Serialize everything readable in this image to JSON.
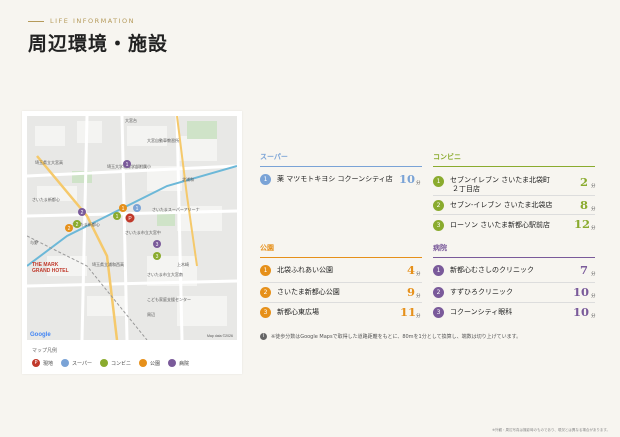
{
  "header": {
    "eyebrow": "LIFE INFORMATION",
    "title": "周辺環境・施設"
  },
  "colors": {
    "super": "#7aa3d6",
    "conv": "#8aab2e",
    "park": "#e6901a",
    "hosp": "#7a5a9a",
    "gen": "#c0392b",
    "gold": "#b59a5a"
  },
  "legend": {
    "title": "マップ凡例",
    "items": [
      {
        "mark": "P",
        "label": "現地"
      },
      {
        "mark": "",
        "label": "スーパー"
      },
      {
        "mark": "",
        "label": "コンビニ"
      },
      {
        "mark": "",
        "label": "公園"
      },
      {
        "mark": "",
        "label": "病院"
      }
    ]
  },
  "map": {
    "credit": "Map data ©2026",
    "logo": "Google",
    "labels": [
      "大宮台",
      "大宮自動車教習所",
      "大宮区",
      "埼玉県立大宮高",
      "埼玉大学教育学部附属小",
      "北浦和",
      "さいたま新都心",
      "さいたま新都心",
      "THE MARK",
      "GRAND HOTEL",
      "埼玉県立浦和西高",
      "さいたまスーパーアリーナ",
      "上木崎",
      "与野",
      "さいたま市立大宮中",
      "さいたま市立大宮南",
      "こども家庭支援センター",
      "周辺"
    ]
  },
  "sections": {
    "super": {
      "title": "スーパー",
      "items": [
        {
          "n": "1",
          "name": "薬 マツモトキヨシ コクーンシティ店",
          "min": "10",
          "unit": "分"
        }
      ]
    },
    "conv": {
      "title": "コンビニ",
      "items": [
        {
          "n": "1",
          "name": "セブンイレブン さいたま北袋町",
          "name2": "２丁目店",
          "min": "2",
          "unit": "分"
        },
        {
          "n": "2",
          "name": "セブン-イレブン さいたま北袋店",
          "min": "8",
          "unit": "分"
        },
        {
          "n": "3",
          "name": "ローソン さいたま新都心駅前店",
          "min": "12",
          "unit": "分"
        }
      ]
    },
    "park": {
      "title": "公園",
      "items": [
        {
          "n": "1",
          "name": "北袋ふれあい公園",
          "min": "4",
          "unit": "分"
        },
        {
          "n": "2",
          "name": "さいたま新都心公園",
          "min": "9",
          "unit": "分"
        },
        {
          "n": "3",
          "name": "新都心東広場",
          "min": "11",
          "unit": "分"
        }
      ]
    },
    "hosp": {
      "title": "病院",
      "items": [
        {
          "n": "1",
          "name": "新都心むさしのクリニック",
          "min": "7",
          "unit": "分"
        },
        {
          "n": "2",
          "name": "すずひろクリニック",
          "min": "10",
          "unit": "分"
        },
        {
          "n": "3",
          "name": "コクーンシティ眼科",
          "min": "10",
          "unit": "分"
        }
      ]
    }
  },
  "note": {
    "icon": "i",
    "text": "※徒歩分数はGoogle Mapsで取得した道路距離をもとに、80mを1分として換算し、端数は切り上げています。"
  },
  "footer": "※外観・周辺写真は撮影時のものであり、現況とは異なる場合があります。"
}
